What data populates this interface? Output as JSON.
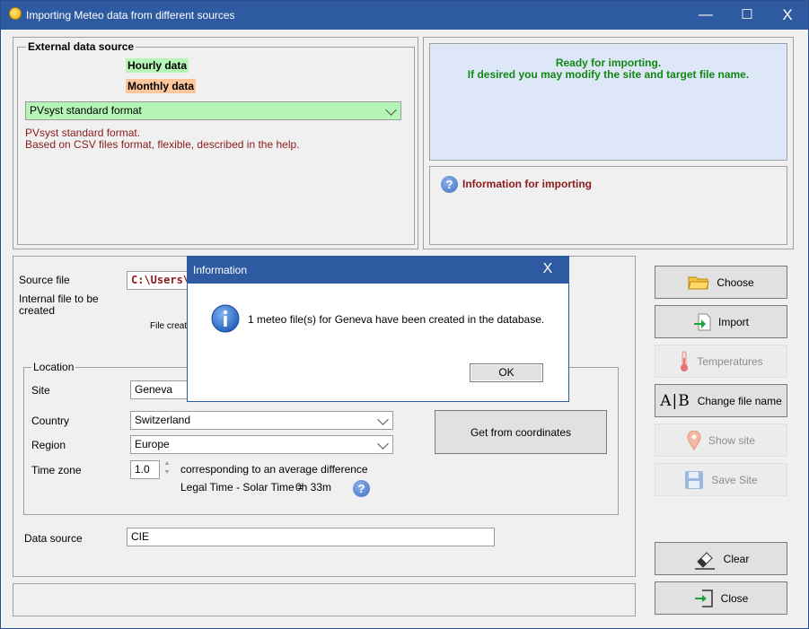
{
  "window": {
    "title": "Importing Meteo data from different sources",
    "minimize_glyph": "—",
    "maximize_glyph": "☐",
    "close_glyph": "X"
  },
  "external_source": {
    "group_label": "External data source",
    "hourly_label": "Hourly data",
    "monthly_label": "Monthly data",
    "format_selected": "PVsyst standard format",
    "description_line1": "PVsyst standard format.",
    "description_line2": "Based on CSV files format, flexible, described in the help."
  },
  "status": {
    "line1": "Ready for importing.",
    "line2": "If desired you may modify the site and target file name."
  },
  "info": {
    "title": "Information for importing"
  },
  "form": {
    "source_file_label": "Source file",
    "source_file_value": "C:\\Users\\PV",
    "internal_file_label_1": "Internal file to be",
    "internal_file_label_2": "created",
    "file_creation_partial": "File creati"
  },
  "location": {
    "group_label": "Location",
    "site_label": "Site",
    "site_value": "Geneva",
    "country_label": "Country",
    "country_value": "Switzerland",
    "region_label": "Region",
    "region_value": "Europe",
    "timezone_label": "Time zone",
    "timezone_value": "1.0",
    "timezone_desc": "corresponding to an average difference",
    "legal_time_label": "Legal Time - Solar Time =",
    "legal_time_value": "0h 33m",
    "get_coords_label": "Get from coordinates"
  },
  "data_source": {
    "label": "Data source",
    "value": "CIE"
  },
  "buttons": {
    "choose": "Choose",
    "import": "Import",
    "temperatures": "Temperatures",
    "change_file_name": "Change file name",
    "show_site": "Show site",
    "save_site": "Save Site",
    "clear": "Clear",
    "close": "Close"
  },
  "dialog": {
    "title": "Information",
    "close_glyph": "X",
    "message": "1 meteo file(s) for Geneva have been created in the database.",
    "ok_label": "OK"
  },
  "colors": {
    "title_bar": "#2d5aa0",
    "hourly_bg": "#b6f7b6",
    "monthly_bg": "#fcc59a",
    "format_bg": "#b5f5b5",
    "status_text": "#118811",
    "dark_red": "#8b1a1a",
    "status_panel_bg": "#dde7f8"
  },
  "icons": {
    "choose": "folder-icon",
    "import": "import-icon",
    "temperatures": "thermometer-icon",
    "change_file_name": "text-cursor-icon",
    "show_site": "map-pin-icon",
    "save_site": "floppy-icon",
    "clear": "eraser-icon",
    "close": "exit-icon",
    "info": "help-icon",
    "dialog": "info-icon"
  }
}
